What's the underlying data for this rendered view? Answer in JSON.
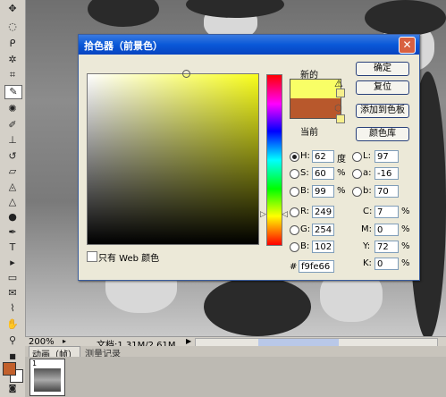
{
  "dialog": {
    "title": "拾色器（前景色）",
    "close_glyph": "✕",
    "webonly_label": "只有 Web 颜色",
    "new_label": "新的",
    "current_label": "当前",
    "new_color": "#f9fe66",
    "current_color": "#b8582c",
    "buttons": {
      "ok": "确定",
      "reset": "复位",
      "add_swatch": "添加到色板",
      "libraries": "颜色库"
    },
    "hsb": {
      "h_label": "H:",
      "h_value": "62",
      "h_unit": "度",
      "s_label": "S:",
      "s_value": "60",
      "s_unit": "%",
      "b_label": "B:",
      "b_value": "99",
      "b_unit": "%"
    },
    "rgb": {
      "r_label": "R:",
      "r_value": "249",
      "g_label": "G:",
      "g_value": "254",
      "b_label": "B:",
      "b_value": "102"
    },
    "lab": {
      "l_label": "L:",
      "l_value": "97",
      "a_label": "a:",
      "a_value": "-16",
      "b_label": "b:",
      "b_value": "70"
    },
    "cmyk": {
      "c_label": "C:",
      "c_value": "7",
      "c_unit": "%",
      "m_label": "M:",
      "m_value": "0",
      "m_unit": "%",
      "y_label": "Y:",
      "y_value": "72",
      "y_unit": "%",
      "k_label": "K:",
      "k_value": "0",
      "k_unit": "%"
    },
    "hex_label": "#",
    "hex_value": "f9fe66"
  },
  "status": {
    "zoom": "200%",
    "doc_info": "文档:1.31M/2.61M"
  },
  "animation": {
    "tab_animation": "动画（帧）",
    "tab_history": "测量记录",
    "frame_number": "1"
  },
  "toolbox": {
    "foreground_color": "#c2602c",
    "background_color": "#ffffff"
  }
}
